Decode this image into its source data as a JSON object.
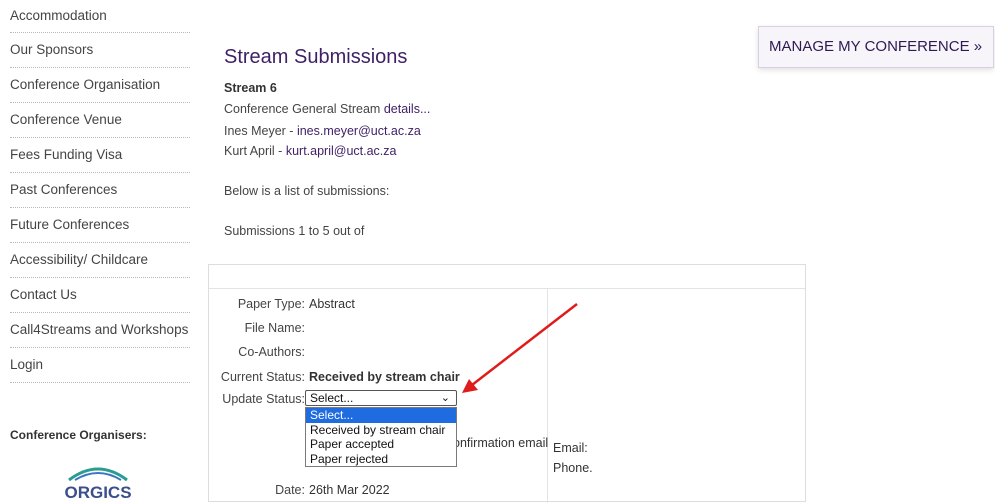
{
  "sidebar": {
    "items": [
      {
        "label": "Accommodation"
      },
      {
        "label": "Our Sponsors"
      },
      {
        "label": "Conference Organisation"
      },
      {
        "label": "Conference Venue"
      },
      {
        "label": "Fees Funding Visa"
      },
      {
        "label": "Past Conferences"
      },
      {
        "label": "Future Conferences"
      },
      {
        "label": "Accessibility/ Childcare"
      },
      {
        "label": "Contact Us"
      },
      {
        "label": "Call4Streams and Workshops"
      },
      {
        "label": "Login"
      }
    ],
    "organisers_title": "Conference Organisers:",
    "logo_text": "ORGICS"
  },
  "manage_button": "MANAGE MY CONFERENCE »",
  "main": {
    "title": "Stream Submissions",
    "stream_name": "Stream 6",
    "stream_desc": "Conference General Stream ",
    "details_link": "details...",
    "chair1_name": "Ines Meyer - ",
    "chair1_email": "ines.meyer@uct.ac.za",
    "chair2_name": "Kurt April - ",
    "chair2_email": "kurt.april@uct.ac.za",
    "list_intro": "Below is a list of submissions:",
    "count_text": "Submissions 1 to 5 out of"
  },
  "submission": {
    "paper_type_label": "Paper Type:",
    "paper_type_value": "Abstract",
    "file_name_label": "File Name:",
    "co_authors_label": "Co-Authors:",
    "current_status_label": "Current Status:",
    "current_status_value": "Received by stream chair",
    "update_status_label": "Update Status:",
    "update_status_selected": "Select...",
    "update_status_options": [
      "Select...",
      "Received by stream chair",
      "Paper accepted",
      "Paper rejected"
    ],
    "confirmation_text": "onfirmation email",
    "email_label": "Email:",
    "phone_label": "Phone.",
    "date_label": "Date:",
    "date_value": "26th Mar 2022"
  },
  "colors": {
    "accent": "#3f1f66",
    "arrow": "#e01b1b",
    "dropdown_highlight": "#1e6ce0"
  }
}
